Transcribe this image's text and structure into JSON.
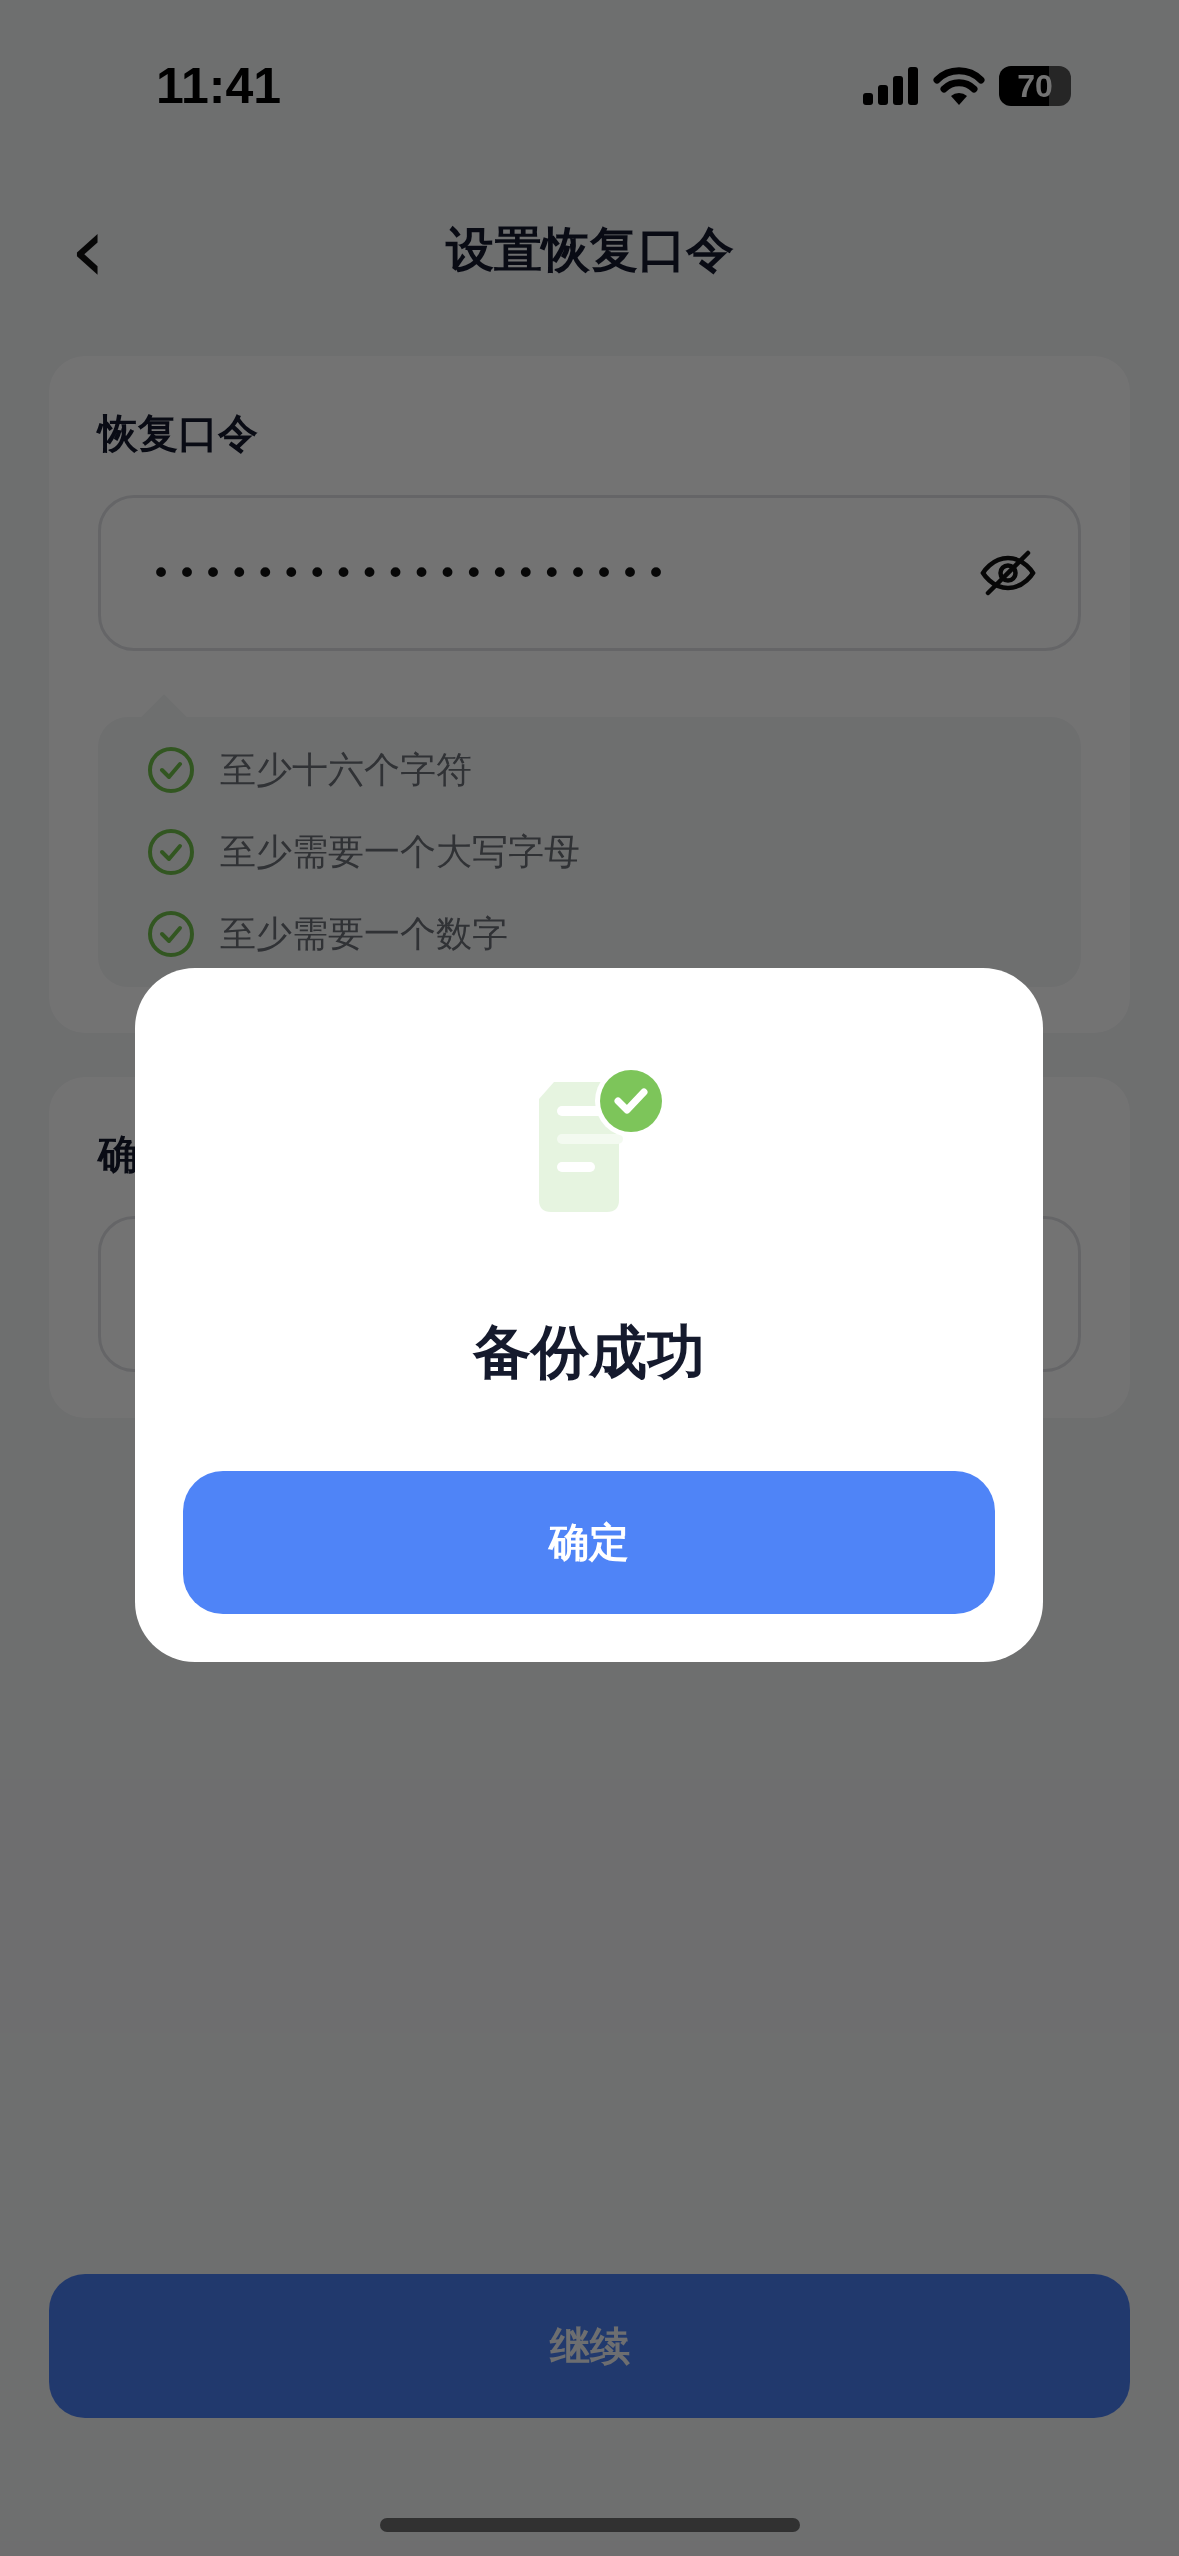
{
  "status_bar": {
    "time": "11:41",
    "battery": "70"
  },
  "nav": {
    "back": "‹",
    "title": "设置恢复口令"
  },
  "password_card": {
    "label": "恢复口令",
    "value": "••••••••••••••••••••",
    "visible": false,
    "requirements": [
      {
        "text": "至少十六个字符",
        "met": true
      },
      {
        "text": "至少需要一个大写字母",
        "met": true
      },
      {
        "text": "至少需要一个数字",
        "met": true
      }
    ]
  },
  "confirm_card": {
    "label": "确"
  },
  "continue_button": {
    "label": "继续"
  },
  "dialog": {
    "title": "备份成功",
    "button": "确定"
  }
}
